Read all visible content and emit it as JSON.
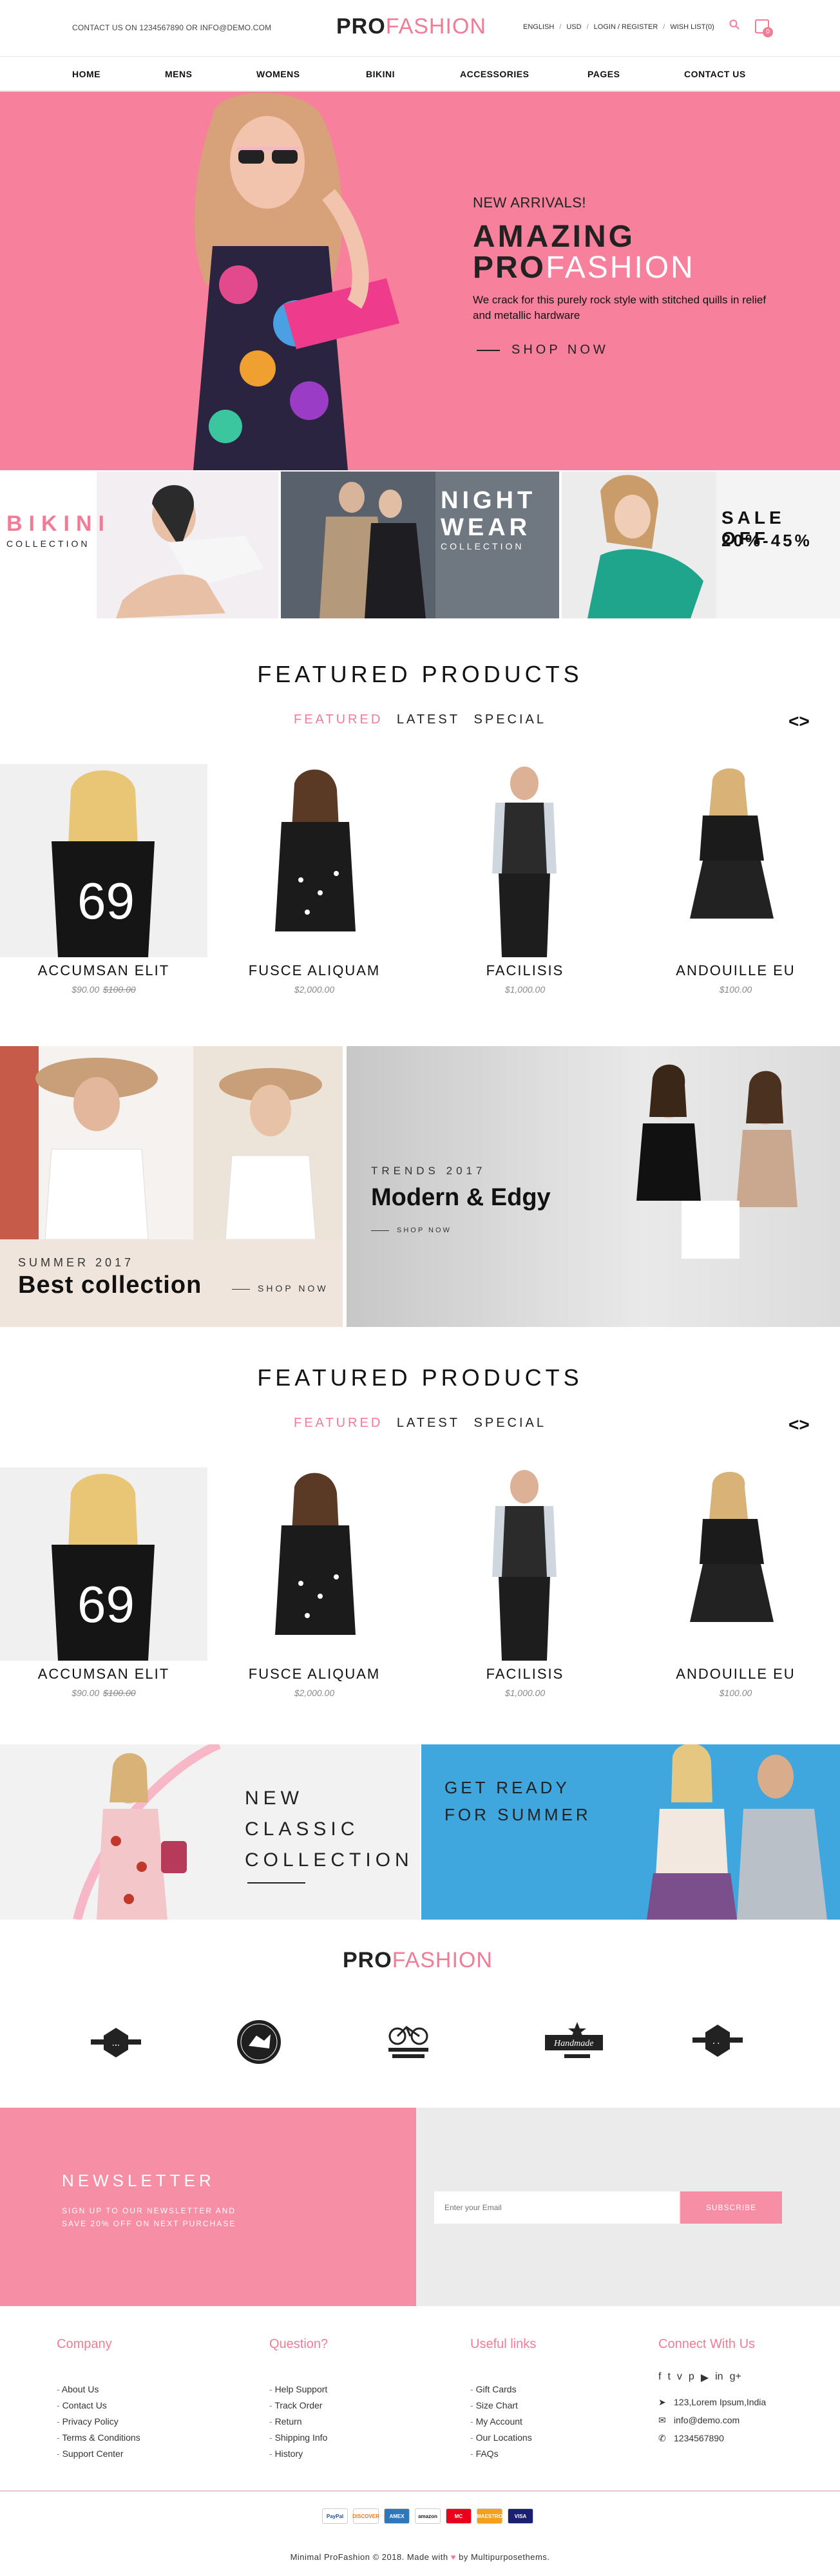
{
  "header": {
    "contact": "CONTACT US ON 1234567890 OR INFO@DEMO.COM",
    "logo_bold": "PRO",
    "logo_light": "FASHION",
    "language": "ENGLISH",
    "currency": "USD",
    "login": "LOGIN / REGISTER",
    "wishlist": "WISH LIST(0)",
    "cart_count": "0"
  },
  "nav": [
    "HOME",
    "MENS",
    "WOMENS",
    "BIKINI",
    "ACCESSORIES",
    "PAGES",
    "CONTACT US"
  ],
  "hero": {
    "eyebrow": "NEW ARRIVALS!",
    "title1": "AMAZING",
    "title2_bold": "PRO",
    "title2_light": "FASHION",
    "description": "We crack for this purely rock style with stitched quills in relief and metallic hardware",
    "cta": "SHOP NOW"
  },
  "banners": {
    "bikini": {
      "title": "BIKINI",
      "subtitle": "COLLECTION"
    },
    "night": {
      "title1": "NIGHT",
      "title2": "WEAR",
      "subtitle": "COLLECTION"
    },
    "sale": {
      "title": "SALE OFF",
      "subtitle": "20%-45%"
    }
  },
  "featured": {
    "title": "FEATURED PRODUCTS",
    "tabs": [
      "FEATURED",
      "LATEST",
      "SPECIAL"
    ],
    "prev": "<",
    "next": ">",
    "products": [
      {
        "name": "ACCUMSAN ELIT",
        "price": "$90.00",
        "old_price": "$100.00"
      },
      {
        "name": "FUSCE ALIQUAM",
        "price": "$2,000.00",
        "old_price": ""
      },
      {
        "name": "FACILISIS",
        "price": "$1,000.00",
        "old_price": ""
      },
      {
        "name": "ANDOUILLE EU",
        "price": "$100.00",
        "old_price": ""
      }
    ]
  },
  "promo": {
    "left": {
      "season": "SUMMER 2017",
      "title": "Best collection",
      "cta": "SHOP NOW"
    },
    "right": {
      "season": "TRENDS 2017",
      "title": "Modern & Edgy",
      "cta": "SHOP NOW"
    }
  },
  "collections": {
    "left": {
      "line1": "NEW",
      "line2": "CLASSIC",
      "line3": "COLLECTION"
    },
    "right": {
      "line1": "GET READY",
      "line2": "FOR SUMMER"
    }
  },
  "brands": {
    "logo_bold": "PRO",
    "logo_light": "FASHION",
    "items": [
      "brand-badge-1",
      "brand-badge-2",
      "bicycle-company",
      "handmade",
      "brand-badge-5"
    ]
  },
  "newsletter": {
    "title": "NEWSLETTER",
    "description": "SIGN UP TO OUR NEWSLETTER AND SAVE 20% OFF ON NEXT PURCHASE",
    "placeholder": "Enter your Email",
    "button": "SUBSCRIBE"
  },
  "footer": {
    "company": {
      "title": "Company",
      "items": [
        "About Us",
        "Contact Us",
        "Privacy Policy",
        "Terms & Conditions",
        "Support Center"
      ]
    },
    "question": {
      "title": "Question?",
      "items": [
        "Help Support",
        "Track Order",
        "Return",
        "Shipping Info",
        "History"
      ]
    },
    "useful": {
      "title": "Useful links",
      "items": [
        "Gift Cards",
        "Size Chart",
        "My Account",
        "Our Locations",
        "FAQs"
      ]
    },
    "connect": {
      "title": "Connect With Us",
      "address": "123,Lorem Ipsum,India",
      "email": "info@demo.com",
      "phone": "1234567890"
    },
    "payments": [
      "PayPal",
      "DISCOVER",
      "AMEX",
      "amazon",
      "MC",
      "MAESTRO",
      "VISA"
    ],
    "copyright_pre": "Minimal ProFashion © 2018. Made with",
    "copyright_post": "by Multipurposethems."
  },
  "colors": {
    "accent": "#f27c96",
    "hero_bg": "#f7809c",
    "summer_bg": "#40a6de",
    "newsletter_bg": "#f68ea6"
  }
}
